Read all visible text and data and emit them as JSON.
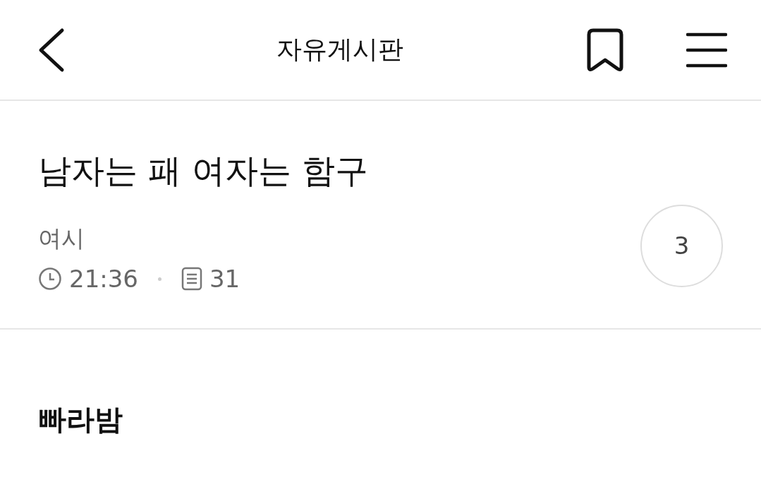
{
  "header": {
    "title": "자유게시판"
  },
  "post": {
    "title": "남자는 패 여자는 함구",
    "author": "여시",
    "time": "21:36",
    "views": "31",
    "comment_count": "3"
  },
  "body": {
    "text": "빠라밤"
  }
}
